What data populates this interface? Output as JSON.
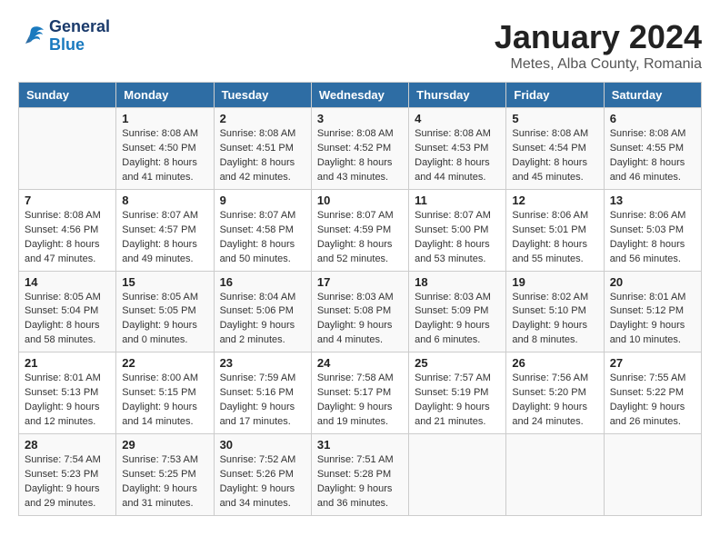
{
  "logo": {
    "line1": "General",
    "line2": "Blue"
  },
  "title": "January 2024",
  "subtitle": "Metes, Alba County, Romania",
  "weekdays": [
    "Sunday",
    "Monday",
    "Tuesday",
    "Wednesday",
    "Thursday",
    "Friday",
    "Saturday"
  ],
  "weeks": [
    [
      {
        "day": "",
        "info": ""
      },
      {
        "day": "1",
        "info": "Sunrise: 8:08 AM\nSunset: 4:50 PM\nDaylight: 8 hours\nand 41 minutes."
      },
      {
        "day": "2",
        "info": "Sunrise: 8:08 AM\nSunset: 4:51 PM\nDaylight: 8 hours\nand 42 minutes."
      },
      {
        "day": "3",
        "info": "Sunrise: 8:08 AM\nSunset: 4:52 PM\nDaylight: 8 hours\nand 43 minutes."
      },
      {
        "day": "4",
        "info": "Sunrise: 8:08 AM\nSunset: 4:53 PM\nDaylight: 8 hours\nand 44 minutes."
      },
      {
        "day": "5",
        "info": "Sunrise: 8:08 AM\nSunset: 4:54 PM\nDaylight: 8 hours\nand 45 minutes."
      },
      {
        "day": "6",
        "info": "Sunrise: 8:08 AM\nSunset: 4:55 PM\nDaylight: 8 hours\nand 46 minutes."
      }
    ],
    [
      {
        "day": "7",
        "info": "Sunrise: 8:08 AM\nSunset: 4:56 PM\nDaylight: 8 hours\nand 47 minutes."
      },
      {
        "day": "8",
        "info": "Sunrise: 8:07 AM\nSunset: 4:57 PM\nDaylight: 8 hours\nand 49 minutes."
      },
      {
        "day": "9",
        "info": "Sunrise: 8:07 AM\nSunset: 4:58 PM\nDaylight: 8 hours\nand 50 minutes."
      },
      {
        "day": "10",
        "info": "Sunrise: 8:07 AM\nSunset: 4:59 PM\nDaylight: 8 hours\nand 52 minutes."
      },
      {
        "day": "11",
        "info": "Sunrise: 8:07 AM\nSunset: 5:00 PM\nDaylight: 8 hours\nand 53 minutes."
      },
      {
        "day": "12",
        "info": "Sunrise: 8:06 AM\nSunset: 5:01 PM\nDaylight: 8 hours\nand 55 minutes."
      },
      {
        "day": "13",
        "info": "Sunrise: 8:06 AM\nSunset: 5:03 PM\nDaylight: 8 hours\nand 56 minutes."
      }
    ],
    [
      {
        "day": "14",
        "info": "Sunrise: 8:05 AM\nSunset: 5:04 PM\nDaylight: 8 hours\nand 58 minutes."
      },
      {
        "day": "15",
        "info": "Sunrise: 8:05 AM\nSunset: 5:05 PM\nDaylight: 9 hours\nand 0 minutes."
      },
      {
        "day": "16",
        "info": "Sunrise: 8:04 AM\nSunset: 5:06 PM\nDaylight: 9 hours\nand 2 minutes."
      },
      {
        "day": "17",
        "info": "Sunrise: 8:03 AM\nSunset: 5:08 PM\nDaylight: 9 hours\nand 4 minutes."
      },
      {
        "day": "18",
        "info": "Sunrise: 8:03 AM\nSunset: 5:09 PM\nDaylight: 9 hours\nand 6 minutes."
      },
      {
        "day": "19",
        "info": "Sunrise: 8:02 AM\nSunset: 5:10 PM\nDaylight: 9 hours\nand 8 minutes."
      },
      {
        "day": "20",
        "info": "Sunrise: 8:01 AM\nSunset: 5:12 PM\nDaylight: 9 hours\nand 10 minutes."
      }
    ],
    [
      {
        "day": "21",
        "info": "Sunrise: 8:01 AM\nSunset: 5:13 PM\nDaylight: 9 hours\nand 12 minutes."
      },
      {
        "day": "22",
        "info": "Sunrise: 8:00 AM\nSunset: 5:15 PM\nDaylight: 9 hours\nand 14 minutes."
      },
      {
        "day": "23",
        "info": "Sunrise: 7:59 AM\nSunset: 5:16 PM\nDaylight: 9 hours\nand 17 minutes."
      },
      {
        "day": "24",
        "info": "Sunrise: 7:58 AM\nSunset: 5:17 PM\nDaylight: 9 hours\nand 19 minutes."
      },
      {
        "day": "25",
        "info": "Sunrise: 7:57 AM\nSunset: 5:19 PM\nDaylight: 9 hours\nand 21 minutes."
      },
      {
        "day": "26",
        "info": "Sunrise: 7:56 AM\nSunset: 5:20 PM\nDaylight: 9 hours\nand 24 minutes."
      },
      {
        "day": "27",
        "info": "Sunrise: 7:55 AM\nSunset: 5:22 PM\nDaylight: 9 hours\nand 26 minutes."
      }
    ],
    [
      {
        "day": "28",
        "info": "Sunrise: 7:54 AM\nSunset: 5:23 PM\nDaylight: 9 hours\nand 29 minutes."
      },
      {
        "day": "29",
        "info": "Sunrise: 7:53 AM\nSunset: 5:25 PM\nDaylight: 9 hours\nand 31 minutes."
      },
      {
        "day": "30",
        "info": "Sunrise: 7:52 AM\nSunset: 5:26 PM\nDaylight: 9 hours\nand 34 minutes."
      },
      {
        "day": "31",
        "info": "Sunrise: 7:51 AM\nSunset: 5:28 PM\nDaylight: 9 hours\nand 36 minutes."
      },
      {
        "day": "",
        "info": ""
      },
      {
        "day": "",
        "info": ""
      },
      {
        "day": "",
        "info": ""
      }
    ]
  ]
}
